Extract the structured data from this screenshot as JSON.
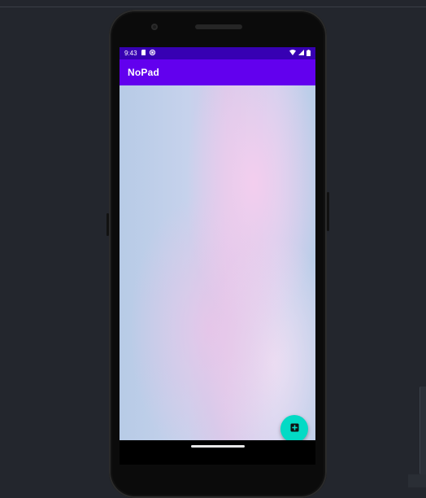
{
  "status_bar": {
    "time": "9:43",
    "left_icons": [
      "sd-card-icon",
      "sync-icon"
    ],
    "right_icons": [
      "wifi-icon",
      "signal-icon",
      "battery-icon"
    ]
  },
  "app_bar": {
    "title": "NoPad"
  },
  "fab": {
    "icon": "add-note-icon",
    "color": "#03dac5"
  },
  "colors": {
    "status_bar": "#3700b3",
    "app_bar": "#6200ee",
    "background_base": "#b9c9e6",
    "background_tint": "#f5ceee"
  }
}
